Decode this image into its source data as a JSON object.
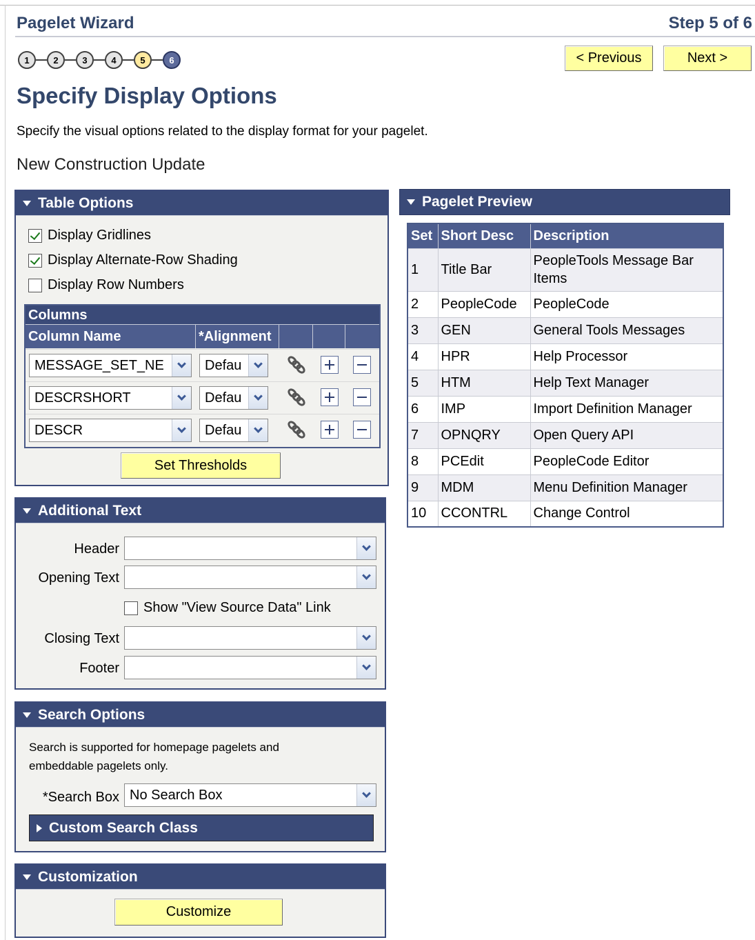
{
  "wizard": {
    "title": "Pagelet Wizard",
    "step_indicator": "Step 5 of 6",
    "steps": [
      "1",
      "2",
      "3",
      "4",
      "5",
      "6"
    ]
  },
  "nav": {
    "previous_label": "< Previous",
    "next_label": "Next >"
  },
  "page": {
    "title": "Specify Display Options",
    "description": "Specify the visual options related to the display format for your pagelet.",
    "pagelet_name": "New Construction Update"
  },
  "table_options": {
    "title": "Table Options",
    "display_gridlines": "Display Gridlines",
    "alt_row_shading": "Display Alternate-Row Shading",
    "row_numbers": "Display Row Numbers",
    "columns_title": "Columns",
    "col_name_header": "Column Name",
    "alignment_header": "*Alignment",
    "rows": [
      {
        "column": "MESSAGE_SET_NE",
        "alignment": "Defau"
      },
      {
        "column": "DESCRSHORT",
        "alignment": "Defau"
      },
      {
        "column": "DESCR",
        "alignment": "Defau"
      }
    ],
    "set_thresholds_label": "Set Thresholds"
  },
  "additional_text": {
    "title": "Additional Text",
    "header_label": "Header",
    "opening_label": "Opening Text",
    "view_source_label": "Show \"View Source Data\" Link",
    "closing_label": "Closing Text",
    "footer_label": "Footer"
  },
  "search_options": {
    "title": "Search Options",
    "note_line1": "Search is supported for homepage pagelets and",
    "note_line2": "embeddable pagelets only.",
    "search_box_label": "*Search Box",
    "search_box_value": "No Search Box",
    "custom_class_label": "Custom Search Class"
  },
  "customization": {
    "title": "Customization",
    "customize_label": "Customize"
  },
  "preview": {
    "title": "Pagelet Preview",
    "headers": [
      "Set",
      "Short Desc",
      "Description"
    ],
    "rows": [
      [
        "1",
        "Title Bar",
        "PeopleTools Message Bar Items"
      ],
      [
        "2",
        "PeopleCode",
        "PeopleCode"
      ],
      [
        "3",
        "GEN",
        "General Tools Messages"
      ],
      [
        "4",
        "HPR",
        "Help Processor"
      ],
      [
        "5",
        "HTM",
        "Help Text Manager"
      ],
      [
        "6",
        "IMP",
        "Import Definition Manager"
      ],
      [
        "7",
        "OPNQRY",
        "Open Query API"
      ],
      [
        "8",
        "PCEdit",
        "PeopleCode Editor"
      ],
      [
        "9",
        "MDM",
        "Menu Definition Manager"
      ],
      [
        "10",
        "CCONTRL",
        "Change Control"
      ]
    ]
  },
  "colors": {
    "header_bg": "#3a4a78",
    "button_bg": "#ffffa0",
    "title_text": "#33476b"
  }
}
